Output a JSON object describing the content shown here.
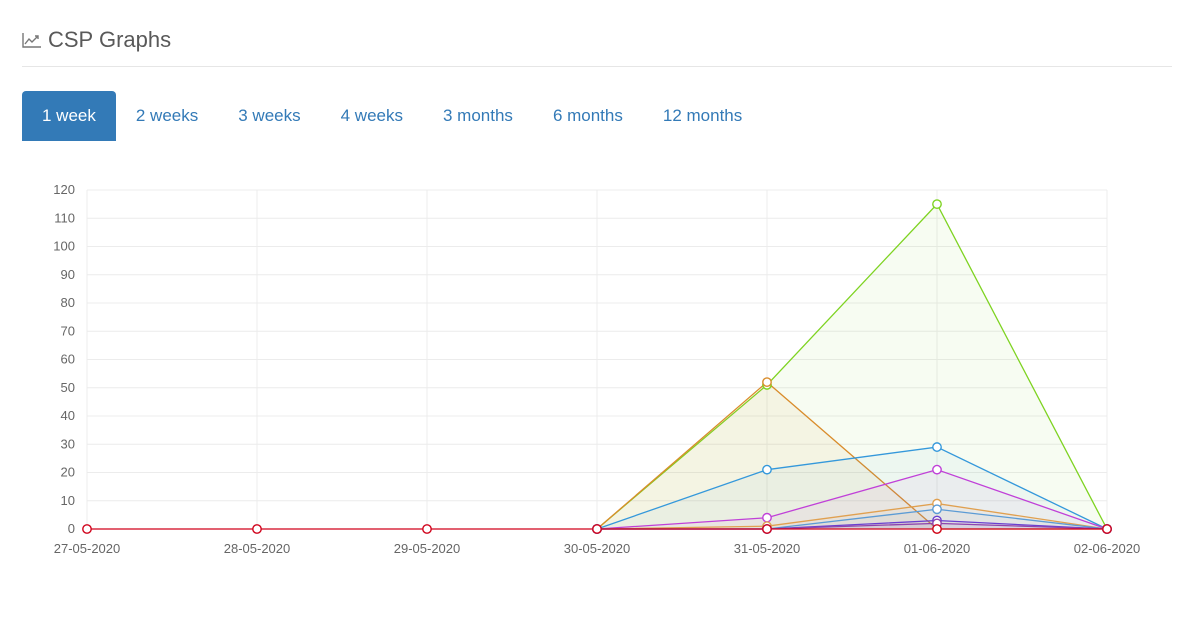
{
  "header": {
    "title": "CSP Graphs",
    "icon": "line-chart-icon"
  },
  "tabs": [
    {
      "label": "1 week",
      "active": true
    },
    {
      "label": "2 weeks",
      "active": false
    },
    {
      "label": "3 weeks",
      "active": false
    },
    {
      "label": "4 weeks",
      "active": false
    },
    {
      "label": "3 months",
      "active": false
    },
    {
      "label": "6 months",
      "active": false
    },
    {
      "label": "12 months",
      "active": false
    }
  ],
  "chart_data": {
    "type": "area",
    "title": "",
    "xlabel": "",
    "ylabel": "",
    "categories": [
      "27-05-2020",
      "28-05-2020",
      "29-05-2020",
      "30-05-2020",
      "31-05-2020",
      "01-06-2020",
      "02-06-2020"
    ],
    "ylim": [
      0,
      120
    ],
    "yticks": [
      0,
      10,
      20,
      30,
      40,
      50,
      60,
      70,
      80,
      90,
      100,
      110,
      120
    ],
    "grid": true,
    "legend": "none",
    "series": [
      {
        "color": "#7ed321",
        "fill": "rgba(126,211,33,0.06)",
        "values": [
          null,
          null,
          null,
          0,
          51,
          115,
          0
        ]
      },
      {
        "color": "#d98c2b",
        "fill": "rgba(217,140,43,0.07)",
        "values": [
          null,
          null,
          null,
          0,
          52,
          0,
          0
        ]
      },
      {
        "color": "#3498db",
        "fill": "rgba(52,152,219,0.05)",
        "values": [
          null,
          null,
          null,
          0,
          21,
          29,
          0
        ]
      },
      {
        "color": "#c040d8",
        "fill": "rgba(192,64,216,0.05)",
        "values": [
          null,
          null,
          null,
          0,
          4,
          21,
          0
        ]
      },
      {
        "color": "#e0a050",
        "fill": "rgba(224,160,80,0.05)",
        "values": [
          null,
          null,
          null,
          0,
          1,
          9,
          0
        ]
      },
      {
        "color": "#5b9bd5",
        "fill": "rgba(91,155,213,0.05)",
        "values": [
          null,
          null,
          null,
          0,
          0,
          7,
          0
        ]
      },
      {
        "color": "#6a3fd0",
        "fill": "rgba(106,63,208,0.05)",
        "values": [
          null,
          null,
          null,
          0,
          0,
          3,
          0
        ]
      },
      {
        "color": "#8e44ad",
        "fill": "rgba(142,68,173,0.05)",
        "values": [
          null,
          null,
          null,
          0,
          0,
          2,
          0
        ]
      },
      {
        "color": "#d0021b",
        "fill": "rgba(208,2,27,0.03)",
        "values": [
          0,
          0,
          0,
          0,
          0,
          0,
          0
        ]
      }
    ]
  }
}
